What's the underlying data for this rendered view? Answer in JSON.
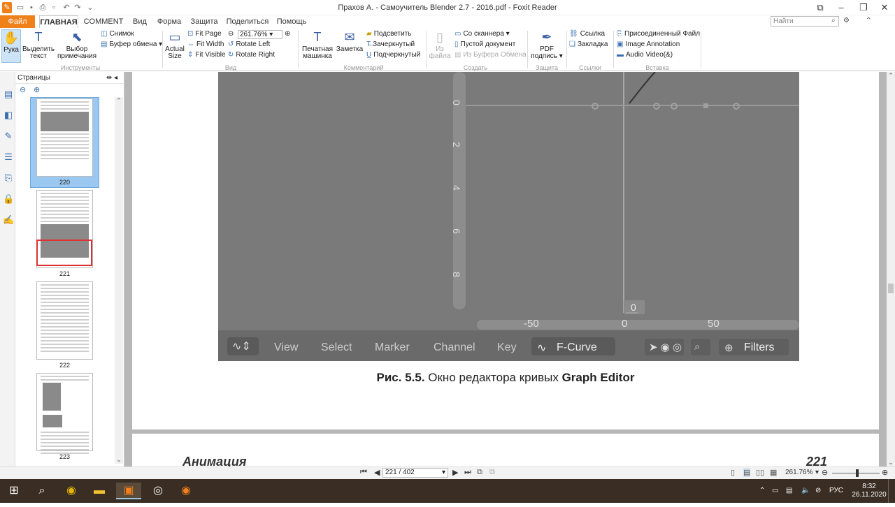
{
  "window": {
    "title": "Прахов А. - Самоучитель Blender 2.7 - 2016.pdf - Foxit Reader"
  },
  "tabs": [
    {
      "label": "Файл"
    },
    {
      "label": "ГЛАВНАЯ"
    },
    {
      "label": "COMMENT"
    },
    {
      "label": "Вид"
    },
    {
      "label": "Форма"
    },
    {
      "label": "Защита"
    },
    {
      "label": "Поделиться"
    },
    {
      "label": "Помощь"
    }
  ],
  "search": {
    "placeholder": "Найти"
  },
  "ribbon": {
    "tools": {
      "hand": "Рука",
      "select_text": "Выделить текст",
      "select_annot": "Выбор примечания",
      "snapshot": "Снимок",
      "clipboard": "Буфер обмена",
      "group": "Инструменты"
    },
    "view": {
      "actual": "Actual Size",
      "fit_page": "Fit Page",
      "fit_width": "Fit Width",
      "fit_visible": "Fit Visible",
      "zoom": "261.76%",
      "rotate_left": "Rotate Left",
      "rotate_right": "Rotate Right",
      "group": "Вид"
    },
    "comments": {
      "typewriter": "Печатная машинка",
      "note": "Заметка",
      "highlight": "Подсветить",
      "strike": "Зачеркнутый",
      "underline": "Подчеркнутый",
      "group": "Комментарий"
    },
    "create": {
      "from_file": "Из файла",
      "scanner": "Со сканнера",
      "blank": "Пустой документ",
      "from_clip": "Из Буфера Обмена",
      "group": "Создать"
    },
    "protect": {
      "pdf_sign": "PDF подпись",
      "group": "Защита"
    },
    "links": {
      "link": "Ссылка",
      "bookmark": "Закладка",
      "group": "Ссылки"
    },
    "insert": {
      "attach": "Присоединенный Файл",
      "image_annot": "Image Annotation",
      "audio": "Audio Video(&)",
      "group": "Вставка"
    }
  },
  "panel": {
    "title": "Страницы",
    "thumbs": [
      {
        "label": "220"
      },
      {
        "label": "221"
      },
      {
        "label": "222"
      },
      {
        "label": "223"
      }
    ]
  },
  "document": {
    "graph": {
      "y_ticks": [
        "0",
        "2",
        "4",
        "6",
        "8"
      ],
      "x_ticks": [
        "-50",
        "0",
        "50"
      ],
      "frame_badge": "0",
      "menu": [
        "View",
        "Select",
        "Marker",
        "Channel",
        "Key"
      ],
      "mode": "F-Curve",
      "filters": "Filters"
    },
    "caption_bold": "Рис. 5.5.",
    "caption_text": " Окно редактора кривых ",
    "caption_bold2": "Graph Editor",
    "next_page_title": "Анимация",
    "next_page_num": "221"
  },
  "status": {
    "page": "221 / 402",
    "zoom": "261.76%"
  },
  "taskbar": {
    "lang": "РУС",
    "time": "8:32",
    "date": "26.11.2020"
  }
}
